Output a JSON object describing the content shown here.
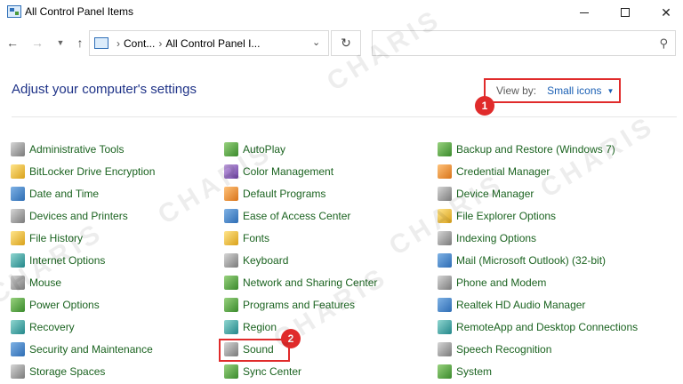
{
  "window": {
    "title": "All Control Panel Items"
  },
  "nav": {
    "address_segments": [
      "Cont...",
      "All Control Panel I..."
    ],
    "search_placeholder": ""
  },
  "header": {
    "title": "Adjust your computer's settings",
    "view_by_label": "View by:",
    "view_by_value": "Small icons"
  },
  "annotations": {
    "step_1": "1",
    "step_2": "2"
  },
  "watermark": "CHARIS",
  "items": [
    {
      "label": "Administrative Tools",
      "icon": "admin-tools-icon"
    },
    {
      "label": "BitLocker Drive Encryption",
      "icon": "bitlocker-icon"
    },
    {
      "label": "Date and Time",
      "icon": "clock-icon"
    },
    {
      "label": "Devices and Printers",
      "icon": "printer-icon"
    },
    {
      "label": "File History",
      "icon": "file-history-icon"
    },
    {
      "label": "Internet Options",
      "icon": "globe-icon"
    },
    {
      "label": "Mouse",
      "icon": "mouse-icon"
    },
    {
      "label": "Power Options",
      "icon": "battery-icon"
    },
    {
      "label": "Recovery",
      "icon": "recovery-icon"
    },
    {
      "label": "Security and Maintenance",
      "icon": "flag-icon"
    },
    {
      "label": "Storage Spaces",
      "icon": "storage-icon"
    },
    {
      "label": "AutoPlay",
      "icon": "autoplay-icon"
    },
    {
      "label": "Color Management",
      "icon": "color-icon"
    },
    {
      "label": "Default Programs",
      "icon": "default-programs-icon"
    },
    {
      "label": "Ease of Access Center",
      "icon": "ease-access-icon"
    },
    {
      "label": "Fonts",
      "icon": "font-icon"
    },
    {
      "label": "Keyboard",
      "icon": "keyboard-icon"
    },
    {
      "label": "Network and Sharing Center",
      "icon": "network-icon"
    },
    {
      "label": "Programs and Features",
      "icon": "programs-icon"
    },
    {
      "label": "Region",
      "icon": "region-icon"
    },
    {
      "label": "Sound",
      "icon": "speaker-icon"
    },
    {
      "label": "Sync Center",
      "icon": "sync-icon"
    },
    {
      "label": "Backup and Restore (Windows 7)",
      "icon": "backup-icon"
    },
    {
      "label": "Credential Manager",
      "icon": "credential-icon"
    },
    {
      "label": "Device Manager",
      "icon": "device-manager-icon"
    },
    {
      "label": "File Explorer Options",
      "icon": "folder-options-icon"
    },
    {
      "label": "Indexing Options",
      "icon": "indexing-icon"
    },
    {
      "label": "Mail (Microsoft Outlook) (32-bit)",
      "icon": "mail-icon"
    },
    {
      "label": "Phone and Modem",
      "icon": "phone-icon"
    },
    {
      "label": "Realtek HD Audio Manager",
      "icon": "audio-manager-icon"
    },
    {
      "label": "RemoteApp and Desktop Connections",
      "icon": "remote-desktop-icon"
    },
    {
      "label": "Speech Recognition",
      "icon": "microphone-icon"
    },
    {
      "label": "System",
      "icon": "system-icon"
    }
  ]
}
